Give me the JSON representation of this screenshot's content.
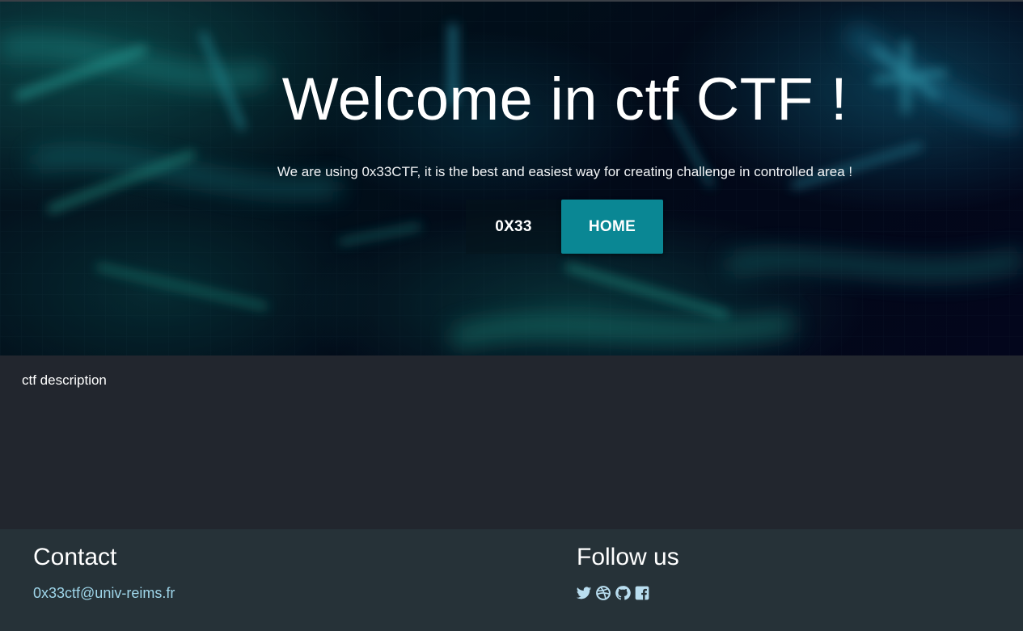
{
  "hero": {
    "title": "Welcome in ctf CTF !",
    "subtitle": "We are using 0x33CTF, it is the best and easiest way for creating challenge in controlled area !",
    "buttons": [
      {
        "label": "0X33"
      },
      {
        "label": "HOME"
      }
    ]
  },
  "description": {
    "text": "ctf description"
  },
  "footer": {
    "contact_title": "Contact",
    "contact_email": "0x33ctf@univ-reims.fr",
    "follow_title": "Follow us",
    "social_icons": [
      "twitter-icon",
      "dribbble-icon",
      "github-icon",
      "facebook-icon"
    ]
  },
  "colors": {
    "accent": "#0a8794",
    "link": "#9fd6ea",
    "footer_bg": "#263238",
    "content_bg": "#22262e"
  }
}
